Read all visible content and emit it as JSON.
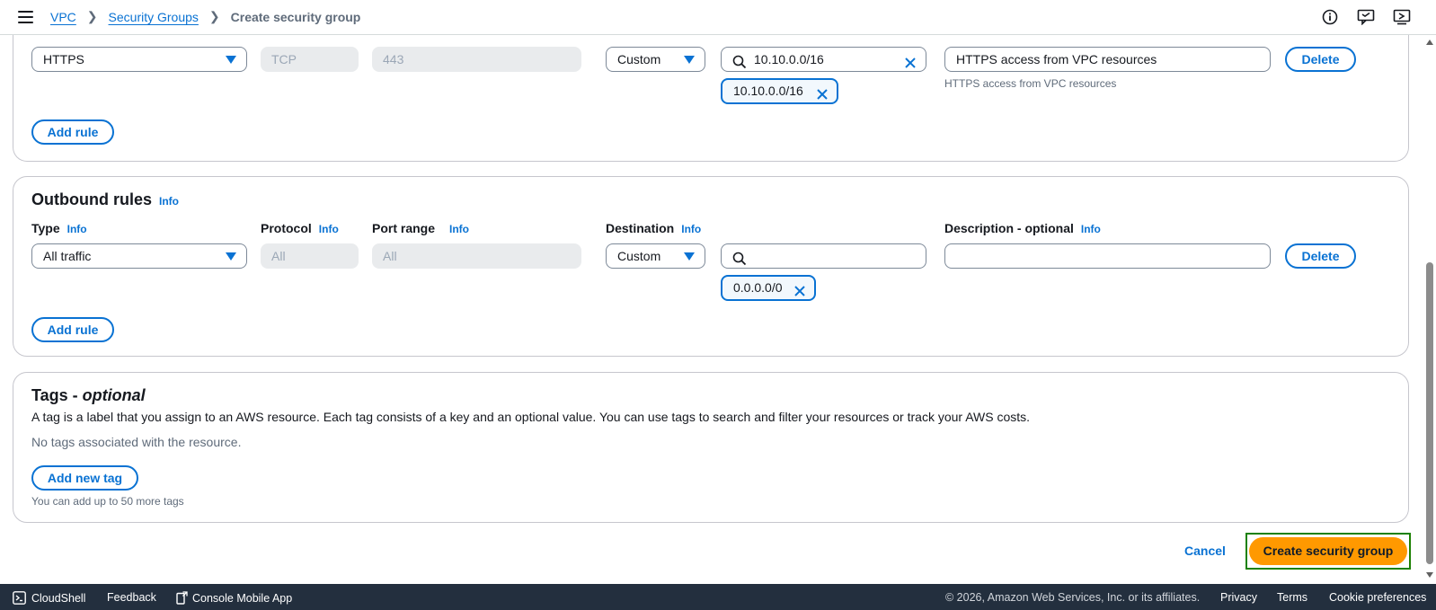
{
  "breadcrumb": {
    "items": [
      "VPC",
      "Security Groups"
    ],
    "current": "Create security group"
  },
  "header_icons": [
    "info-icon",
    "feedback-icon",
    "console-icon"
  ],
  "inbound": {
    "rule": {
      "type": "HTTPS",
      "protocol": "TCP",
      "port_range": "443",
      "source_mode": "Custom",
      "source_search": "10.10.0.0/16",
      "token": "10.10.0.0/16",
      "description": "HTTPS access from VPC resources",
      "description_hint": "HTTPS access from VPC resources",
      "delete_label": "Delete"
    },
    "add_rule_label": "Add rule"
  },
  "outbound": {
    "title": "Outbound rules",
    "info": "Info",
    "columns": {
      "type": "Type",
      "protocol": "Protocol",
      "port_range": "Port range",
      "destination": "Destination",
      "description": "Description - optional"
    },
    "rule": {
      "type": "All traffic",
      "protocol": "All",
      "port_range": "All",
      "destination_mode": "Custom",
      "destination_search": "",
      "token": "0.0.0.0/0",
      "description": "",
      "delete_label": "Delete"
    },
    "add_rule_label": "Add rule"
  },
  "tags": {
    "title": "Tags - ",
    "title_italic": "optional",
    "description": "A tag is a label that you assign to an AWS resource. Each tag consists of a key and an optional value. You can use tags to search and filter your resources or track your AWS costs.",
    "empty": "No tags associated with the resource.",
    "add_label": "Add new tag",
    "hint": "You can add up to 50 more tags"
  },
  "actions": {
    "cancel": "Cancel",
    "create": "Create security group"
  },
  "footer": {
    "cloudshell": "CloudShell",
    "feedback": "Feedback",
    "mobile": "Console Mobile App",
    "copyright": "© 2026, Amazon Web Services, Inc. or its affiliates.",
    "privacy": "Privacy",
    "terms": "Terms",
    "cookies": "Cookie preferences"
  },
  "colors": {
    "link": "#0972d3",
    "primary": "#ff9900",
    "footer_bg": "#232f3e",
    "highlight": "#1d8102"
  }
}
